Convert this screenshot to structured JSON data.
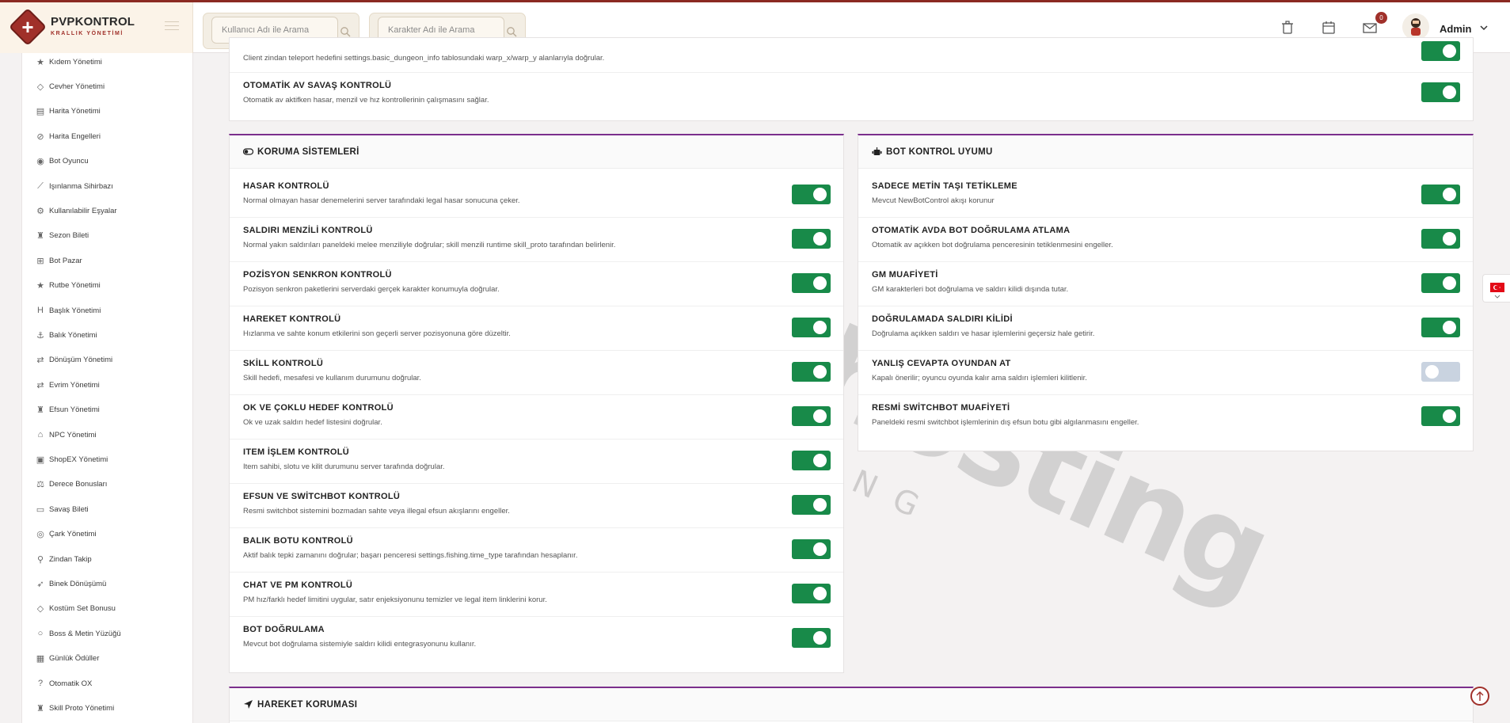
{
  "brand": {
    "title": "PVPKONTROL",
    "subtitle": "KRALLIK YÖNETİMİ"
  },
  "search": {
    "user_placeholder": "Kullanıcı Adı ile Arama",
    "char_placeholder": "Karakter Adı ile Arama"
  },
  "header": {
    "notif_count": "0",
    "admin_name": "Admin"
  },
  "sidebar": {
    "items": [
      {
        "label": "Kıdem Yönetimi",
        "icon": "star-icon"
      },
      {
        "label": "Cevher Yönetimi",
        "icon": "gem-icon"
      },
      {
        "label": "Harita Yönetimi",
        "icon": "map-icon"
      },
      {
        "label": "Harita Engelleri",
        "icon": "ban-icon"
      },
      {
        "label": "Bot Oyuncu",
        "icon": "android-icon"
      },
      {
        "label": "Işınlanma Sihirbazı",
        "icon": "wand-icon"
      },
      {
        "label": "Kullanılabilir Eşyalar",
        "icon": "cogs-icon"
      },
      {
        "label": "Sezon Bileti",
        "icon": "trophy-icon"
      },
      {
        "label": "Bot Pazar",
        "icon": "cart-icon"
      },
      {
        "label": "Rutbe Yönetimi",
        "icon": "star-icon"
      },
      {
        "label": "Başlık Yönetimi",
        "icon": "heading-icon"
      },
      {
        "label": "Balık Yönetimi",
        "icon": "anchor-icon"
      },
      {
        "label": "Dönüşüm Yönetimi",
        "icon": "shuffle-icon"
      },
      {
        "label": "Evrim Yönetimi",
        "icon": "shuffle-icon"
      },
      {
        "label": "Efsun Yönetimi",
        "icon": "trophy-icon"
      },
      {
        "label": "NPC Yönetimi",
        "icon": "bank-icon"
      },
      {
        "label": "ShopEX Yönetimi",
        "icon": "store-icon"
      },
      {
        "label": "Derece Bonusları",
        "icon": "scale-icon"
      },
      {
        "label": "Savaş Bileti",
        "icon": "ticket-icon"
      },
      {
        "label": "Çark Yönetimi",
        "icon": "wheel-icon"
      },
      {
        "label": "Zindan Takip",
        "icon": "pin-icon"
      },
      {
        "label": "Binek Dönüşümü",
        "icon": "rocket-icon"
      },
      {
        "label": "Kostüm Set Bonusu",
        "icon": "gem-icon"
      },
      {
        "label": "Boss & Metin Yüzüğü",
        "icon": "ring-icon"
      },
      {
        "label": "Günlük Ödüller",
        "icon": "calendar-icon"
      },
      {
        "label": "Otomatik OX",
        "icon": "question-icon"
      },
      {
        "label": "Skill Proto Yönetimi",
        "icon": "trophy-icon"
      }
    ]
  },
  "top_card": {
    "rows": [
      {
        "desc": "Client zindan teleport hedefini settings.basic_dungeon_info tablosundaki warp_x/warp_y alanlarıyla doğrular.",
        "on": true
      },
      {
        "title": "OTOMATİK AV SAVAŞ KONTROLÜ",
        "desc": "Otomatik av aktifken hasar, menzil ve hız kontrollerinin çalışmasını sağlar.",
        "on": true
      }
    ]
  },
  "koruma": {
    "title": "KORUMA SİSTEMLERİ",
    "rows": [
      {
        "title": "HASAR KONTROLÜ",
        "desc": "Normal olmayan hasar denemelerini server tarafındaki legal hasar sonucuna çeker.",
        "on": true
      },
      {
        "title": "SALDIRI MENZİLİ KONTROLÜ",
        "desc": "Normal yakın saldırıları paneldeki melee menziliyle doğrular; skill menzili runtime skill_proto tarafından belirlenir.",
        "on": true
      },
      {
        "title": "POZİSYON SENKRON KONTROLÜ",
        "desc": "Pozisyon senkron paketlerini serverdaki gerçek karakter konumuyla doğrular.",
        "on": true
      },
      {
        "title": "HAREKET KONTROLÜ",
        "desc": "Hızlanma ve sahte konum etkilerini son geçerli server pozisyonuna göre düzeltir.",
        "on": true
      },
      {
        "title": "SKİLL KONTROLÜ",
        "desc": "Skill hedefi, mesafesi ve kullanım durumunu doğrular.",
        "on": true
      },
      {
        "title": "OK VE ÇOKLU HEDEF KONTROLÜ",
        "desc": "Ok ve uzak saldırı hedef listesini doğrular.",
        "on": true
      },
      {
        "title": "ITEM İŞLEM KONTROLÜ",
        "desc": "Item sahibi, slotu ve kilit durumunu server tarafında doğrular.",
        "on": true
      },
      {
        "title": "EFSUN VE SWİTCHBOT KONTROLÜ",
        "desc": "Resmi switchbot sistemini bozmadan sahte veya illegal efsun akışlarını engeller.",
        "on": true
      },
      {
        "title": "BALIK BOTU KONTROLÜ",
        "desc": "Aktif balık tepki zamanını doğrular; başarı penceresi settings.fishing.time_type tarafından hesaplanır.",
        "on": true
      },
      {
        "title": "CHAT VE PM KONTROLÜ",
        "desc": "PM hız/farklı hedef limitini uygular, satır enjeksiyonunu temizler ve legal item linklerini korur.",
        "on": true
      },
      {
        "title": "BOT DOĞRULAMA",
        "desc": "Mevcut bot doğrulama sistemiyle saldırı kilidi entegrasyonunu kullanır.",
        "on": true
      }
    ]
  },
  "bot": {
    "title": "BOT KONTROL UYUMU",
    "rows": [
      {
        "title": "SADECE METİN TAŞI TETİKLEME",
        "desc": "Mevcut NewBotControl akışı korunur",
        "on": true
      },
      {
        "title": "OTOMATİK AVDA BOT DOĞRULAMA ATLAMA",
        "desc": "Otomatik av açıkken bot doğrulama penceresinin tetiklenmesini engeller.",
        "on": true
      },
      {
        "title": "GM MUAFİYETİ",
        "desc": "GM karakterleri bot doğrulama ve saldırı kilidi dışında tutar.",
        "on": true
      },
      {
        "title": "DOĞRULAMADA SALDIRI KİLİDİ",
        "desc": "Doğrulama açıkken saldırı ve hasar işlemlerini geçersiz hale getirir.",
        "on": true
      },
      {
        "title": "YANLIŞ CEVAPTA OYUNDAN AT",
        "desc": "Kapalı önerilir; oyuncu oyunda kalır ama saldırı işlemleri kilitlenir.",
        "on": false
      },
      {
        "title": "RESMİ SWİTCHBOT MUAFİYETİ",
        "desc": "Paneldeki resmi switchbot işlemlerinin dış efsun botu gibi algılanmasını engeller.",
        "on": true
      }
    ]
  },
  "hareket": {
    "title": "HAREKET KORUMASI"
  },
  "watermark": {
    "main": "buyukhosting",
    "sub": "LARGE HOSTING SOLUTIONS"
  },
  "colors": {
    "accent": "#a0302a",
    "toggle_on": "#188a49",
    "toggle_off": "#c9d3e0",
    "card_accent": "#7b2f8c"
  }
}
